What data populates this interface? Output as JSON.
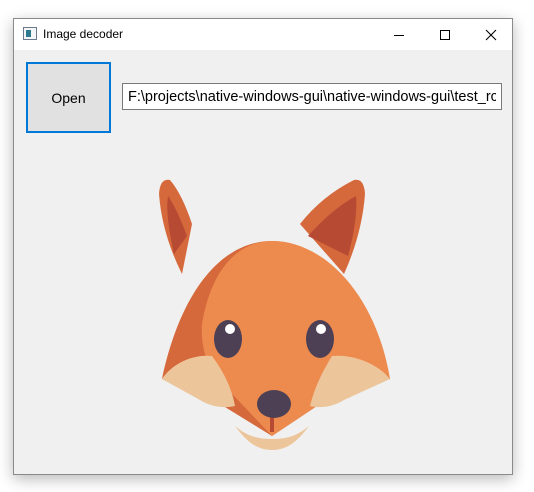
{
  "window": {
    "title": "Image decoder",
    "icon": "app-window-icon",
    "controls": {
      "minimize_icon": "minimize-icon",
      "maximize_icon": "maximize-icon",
      "close_icon": "close-icon"
    }
  },
  "toolbar": {
    "open_label": "Open",
    "path_value": "F:\\projects\\native-windows-gui\\native-windows-gui\\test_rc\\fox.png"
  },
  "image": {
    "icon": "fox-image"
  },
  "colors": {
    "accent": "#0078d7",
    "window_bg": "#f0f0f0",
    "fox_face": "#ed8a4e",
    "fox_shade": "#d6693b",
    "fox_ear_inner": "#b74a33",
    "fox_cheek": "#edc59a",
    "fox_eye": "#4d4055"
  }
}
